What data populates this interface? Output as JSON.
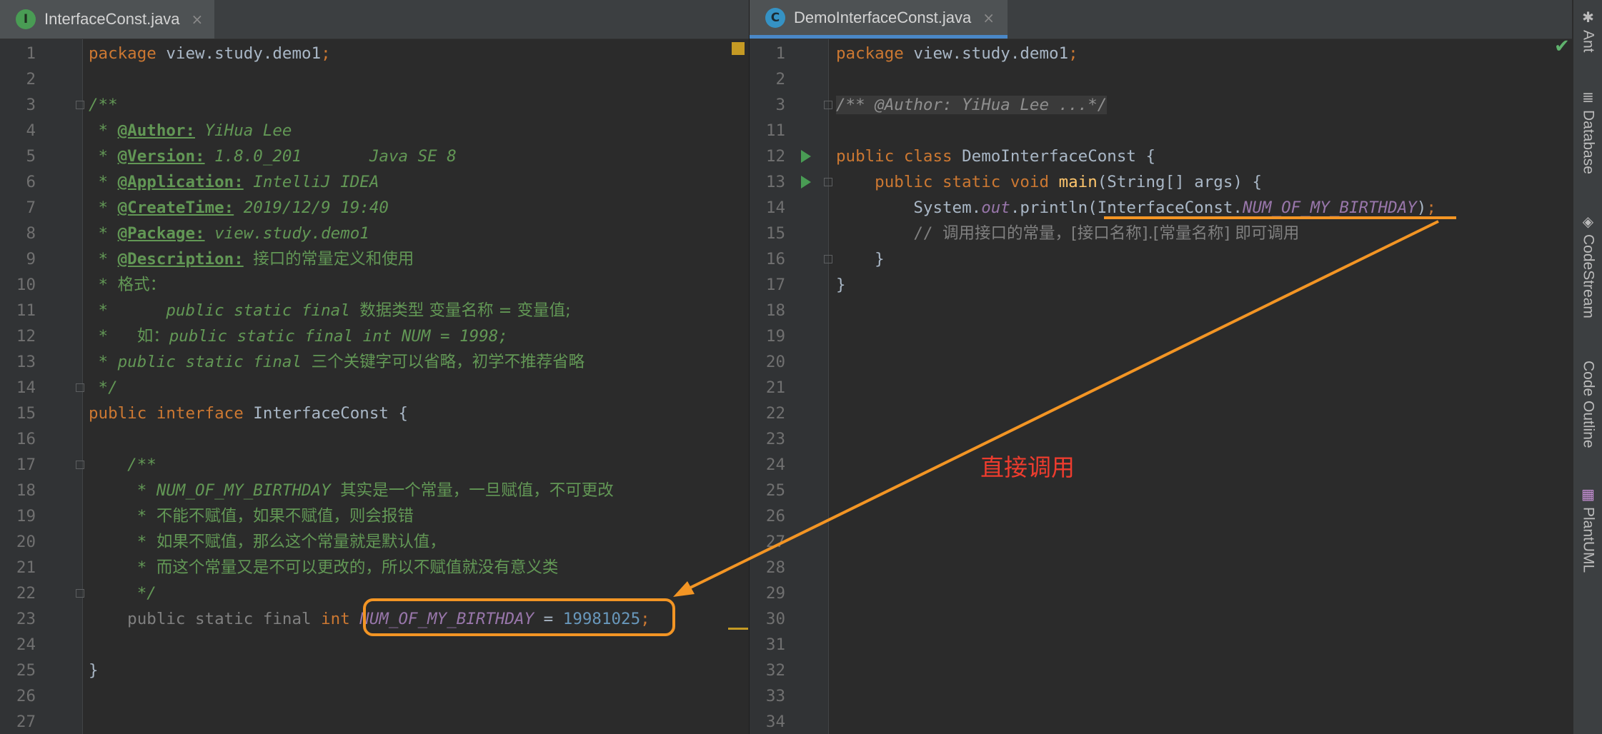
{
  "left_tab": {
    "icon_letter": "I",
    "title": "InterfaceConst.java",
    "close": "×"
  },
  "right_tab": {
    "icon_letter": "C",
    "title": "DemoInterfaceConst.java",
    "close": "×"
  },
  "left_lines": [
    {
      "n": "1",
      "t": [
        [
          "kw",
          "package "
        ],
        [
          "plain",
          "view.study.demo1"
        ],
        [
          "kw",
          ";"
        ]
      ]
    },
    {
      "n": "2",
      "t": []
    },
    {
      "n": "3",
      "t": [
        [
          "doc",
          "/**"
        ]
      ]
    },
    {
      "n": "4",
      "t": [
        [
          "doc",
          " * "
        ],
        [
          "tag",
          "@Author:"
        ],
        [
          "doc",
          " YiHua Lee"
        ]
      ]
    },
    {
      "n": "5",
      "t": [
        [
          "doc",
          " * "
        ],
        [
          "tag",
          "@Version:"
        ],
        [
          "doc",
          " 1.8.0_201       Java SE 8"
        ]
      ]
    },
    {
      "n": "6",
      "t": [
        [
          "doc",
          " * "
        ],
        [
          "tag",
          "@Application:"
        ],
        [
          "doc",
          " IntelliJ IDEA"
        ]
      ]
    },
    {
      "n": "7",
      "t": [
        [
          "doc",
          " * "
        ],
        [
          "tag",
          "@CreateTime:"
        ],
        [
          "doc",
          " 2019/12/9 19:40"
        ]
      ]
    },
    {
      "n": "8",
      "t": [
        [
          "doc",
          " * "
        ],
        [
          "tag",
          "@Package:"
        ],
        [
          "doc",
          " view.study.demo1"
        ]
      ]
    },
    {
      "n": "9",
      "t": [
        [
          "doc",
          " * "
        ],
        [
          "tag",
          "@Description:"
        ],
        [
          "doc",
          " "
        ],
        [
          "doc cjk",
          "接口的常量定义和使用"
        ]
      ]
    },
    {
      "n": "10",
      "t": [
        [
          "doc",
          " * "
        ],
        [
          "doc cjk",
          "格式："
        ]
      ]
    },
    {
      "n": "11",
      "t": [
        [
          "doc",
          " *      public static final "
        ],
        [
          "doc cjk",
          "数据类型 变量名称 = 变量值;"
        ]
      ]
    },
    {
      "n": "12",
      "t": [
        [
          "doc",
          " *   "
        ],
        [
          "doc cjk",
          "如："
        ],
        [
          "doc",
          "public static final int NUM = 1998;"
        ]
      ]
    },
    {
      "n": "13",
      "t": [
        [
          "doc",
          " * public static final "
        ],
        [
          "doc cjk",
          "三个关键字可以省略，初学不推荐省略"
        ]
      ]
    },
    {
      "n": "14",
      "t": [
        [
          "doc",
          " */"
        ]
      ]
    },
    {
      "n": "15",
      "t": [
        [
          "kw",
          "public interface "
        ],
        [
          "plain",
          "InterfaceConst {"
        ]
      ]
    },
    {
      "n": "16",
      "t": []
    },
    {
      "n": "17",
      "t": [
        [
          "doc",
          "    /**"
        ]
      ]
    },
    {
      "n": "18",
      "t": [
        [
          "doc",
          "     * NUM_OF_MY_BIRTHDAY "
        ],
        [
          "doc cjk",
          "其实是一个常量，一旦赋值，不可更改"
        ]
      ]
    },
    {
      "n": "19",
      "t": [
        [
          "doc",
          "     * "
        ],
        [
          "doc cjk",
          "不能不赋值，如果不赋值，则会报错"
        ]
      ]
    },
    {
      "n": "20",
      "t": [
        [
          "doc",
          "     * "
        ],
        [
          "doc cjk",
          "如果不赋值，那么这个常量就是默认值，"
        ]
      ]
    },
    {
      "n": "21",
      "t": [
        [
          "doc",
          "     * "
        ],
        [
          "doc cjk",
          "而这个常量又是不可以更改的，所以不赋值就没有意义类"
        ]
      ]
    },
    {
      "n": "22",
      "t": [
        [
          "doc",
          "     */"
        ]
      ]
    },
    {
      "n": "23",
      "t": [
        [
          "cmt",
          "    public static final "
        ],
        [
          "kw",
          "int "
        ],
        [
          "stat",
          "NUM_OF_MY_BIRTHDAY"
        ],
        [
          "plain",
          " = "
        ],
        [
          "num",
          "19981025"
        ],
        [
          "kw",
          ";"
        ]
      ]
    },
    {
      "n": "24",
      "t": []
    },
    {
      "n": "25",
      "t": [
        [
          "plain",
          "}"
        ]
      ]
    },
    {
      "n": "26",
      "t": []
    },
    {
      "n": "27",
      "t": []
    }
  ],
  "right_lines": [
    {
      "n": "1",
      "t": [
        [
          "kw",
          "package "
        ],
        [
          "plain",
          "view.study.demo1"
        ],
        [
          "kw",
          ";"
        ]
      ]
    },
    {
      "n": "2",
      "t": []
    },
    {
      "n": "3",
      "t": [
        [
          "fold-region",
          "/** @Author: YiHua Lee ...*/"
        ]
      ]
    },
    {
      "n": "11",
      "t": []
    },
    {
      "n": "12",
      "t": [
        [
          "kw",
          "public class "
        ],
        [
          "plain",
          "DemoInterfaceConst {"
        ]
      ]
    },
    {
      "n": "13",
      "t": [
        [
          "kw",
          "    public static void "
        ],
        [
          "fn",
          "main"
        ],
        [
          "plain",
          "(String[] args) {"
        ]
      ]
    },
    {
      "n": "14",
      "t": [
        [
          "plain",
          "        System."
        ],
        [
          "stat",
          "out"
        ],
        [
          "plain",
          ".println(InterfaceConst."
        ],
        [
          "stat",
          "NUM_OF_MY_BIRTHDAY"
        ],
        [
          "plain",
          ")"
        ],
        [
          "kw",
          ";"
        ]
      ]
    },
    {
      "n": "15",
      "t": [
        [
          "cmt",
          "        // "
        ],
        [
          "cmt cjk",
          "调用接口的常量，[接口名称].[常量名称] 即可调用"
        ]
      ]
    },
    {
      "n": "16",
      "t": [
        [
          "plain",
          "    }"
        ]
      ]
    },
    {
      "n": "17",
      "t": [
        [
          "plain",
          "}"
        ]
      ]
    },
    {
      "n": "18",
      "t": []
    },
    {
      "n": "19",
      "t": []
    },
    {
      "n": "20",
      "t": []
    },
    {
      "n": "21",
      "t": []
    },
    {
      "n": "22",
      "t": []
    },
    {
      "n": "23",
      "t": []
    },
    {
      "n": "24",
      "t": []
    },
    {
      "n": "25",
      "t": []
    },
    {
      "n": "26",
      "t": []
    },
    {
      "n": "27",
      "t": []
    },
    {
      "n": "28",
      "t": []
    },
    {
      "n": "29",
      "t": []
    },
    {
      "n": "30",
      "t": []
    },
    {
      "n": "31",
      "t": []
    },
    {
      "n": "32",
      "t": []
    },
    {
      "n": "33",
      "t": []
    },
    {
      "n": "34",
      "t": []
    }
  ],
  "tool_windows": [
    {
      "name": "tool-ant",
      "label": "Ant",
      "icon": "ant-icon",
      "glyph": "🐜"
    },
    {
      "name": "tool-database",
      "label": "Database",
      "icon": "database-icon",
      "glyph": "⛁"
    },
    {
      "name": "tool-codestream",
      "label": "CodeStream",
      "icon": "codestream-icon",
      "glyph": "◈"
    },
    {
      "name": "tool-code-outline",
      "label": "Code Outline",
      "icon": "",
      "glyph": ""
    },
    {
      "name": "tool-plantuml",
      "label": "PlantUML",
      "icon": "plantuml-icon",
      "glyph": "▦"
    }
  ],
  "annotation": {
    "text": "直接调用",
    "color": "#ee3c2e"
  },
  "colors": {
    "accent": "#f39524",
    "tab_underline": "#4a88c7",
    "interface_icon": "#499c54",
    "class_icon": "#3592c4"
  }
}
